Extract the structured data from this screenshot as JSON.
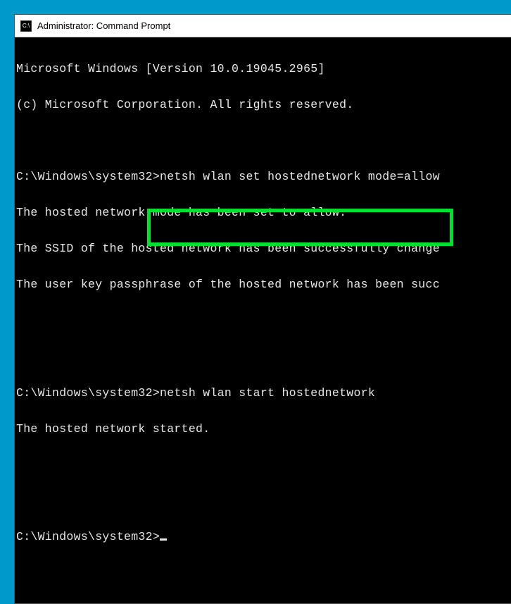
{
  "window": {
    "title": "Administrator: Command Prompt",
    "icon_label": "cmd-icon"
  },
  "terminal": {
    "lines": {
      "l0": "Microsoft Windows [Version 10.0.19045.2965]",
      "l1": "(c) Microsoft Corporation. All rights reserved.",
      "l2": "",
      "l3_prompt": "C:\\Windows\\system32>",
      "l3_cmd": "netsh wlan set hostednetwork mode=allow",
      "l4": "The hosted network mode has been set to allow.",
      "l5": "The SSID of the hosted network has been successfully change",
      "l6": "The user key passphrase of the hosted network has been succ",
      "l7": "",
      "l8": "",
      "l9_prompt": "C:\\Windows\\system32>",
      "l9_cmd": "netsh wlan start hostednetwork",
      "l10": "The hosted network started.",
      "l11": "",
      "l12": "",
      "l13_prompt": "C:\\Windows\\system32>"
    }
  },
  "highlight": {
    "color": "#00e030"
  }
}
